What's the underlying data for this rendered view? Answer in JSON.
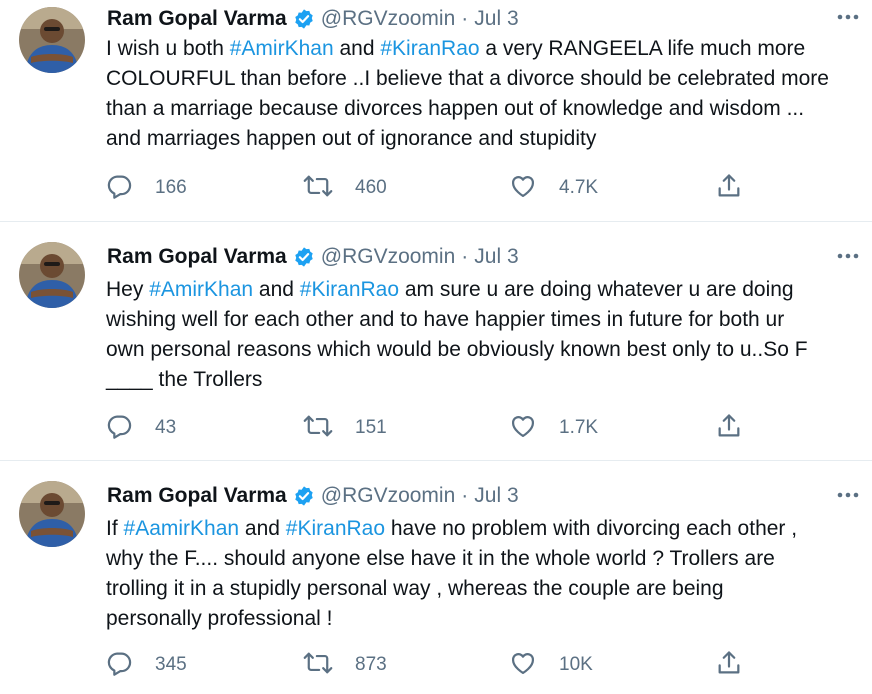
{
  "colors": {
    "hashtag": "#1b95e0",
    "verified": "#1da1f2",
    "muted": "#5b7083",
    "text": "#0f1419"
  },
  "tweets": [
    {
      "author": {
        "name": "Ram Gopal Varma",
        "handle": "@RGVzoomin",
        "separator": "·",
        "date": "Jul 3"
      },
      "lines": [
        [
          {
            "t": "I wish u both  "
          },
          {
            "t": "#AmirKhan",
            "h": true
          },
          {
            "t": " and "
          },
          {
            "t": "#KiranRao",
            "h": true
          },
          {
            "t": " a very RANGEELA life much more"
          }
        ],
        [
          {
            "t": "COLOURFUL than before ..I believe that a divorce should be celebrated more"
          }
        ],
        [
          {
            "t": "than a marriage because divorces happen out of knowledge and wisdom ..."
          }
        ],
        [
          {
            "t": "and marriages happen out of ignorance and stupidity"
          }
        ]
      ],
      "replies": "166",
      "retweets": "460",
      "likes": "4.7K"
    },
    {
      "author": {
        "name": "Ram Gopal Varma",
        "handle": "@RGVzoomin",
        "separator": "·",
        "date": "Jul 3"
      },
      "lines": [
        [
          {
            "t": "Hey "
          },
          {
            "t": "#AmirKhan",
            "h": true
          },
          {
            "t": " and "
          },
          {
            "t": "#KiranRao",
            "h": true
          },
          {
            "t": " am sure u are doing whatever u are doing"
          }
        ],
        [
          {
            "t": "wishing well for each other and to have happier times in future for both ur"
          }
        ],
        [
          {
            "t": "own personal reasons which would be obviously known best only to u..So F"
          }
        ],
        [
          {
            "t": "____ the Trollers"
          }
        ]
      ],
      "replies": "43",
      "retweets": "151",
      "likes": "1.7K"
    },
    {
      "author": {
        "name": "Ram Gopal Varma",
        "handle": "@RGVzoomin",
        "separator": "·",
        "date": "Jul 3"
      },
      "lines": [
        [
          {
            "t": "If  "
          },
          {
            "t": "#AamirKhan",
            "h": true
          },
          {
            "t": " and "
          },
          {
            "t": "#KiranRao",
            "h": true
          },
          {
            "t": " have no problem with divorcing each other ,"
          }
        ],
        [
          {
            "t": "why the F.... should anyone else have it in the whole world ? Trollers are"
          }
        ],
        [
          {
            "t": "trolling it in a stupidly personal way , whereas the couple are being"
          }
        ],
        [
          {
            "t": "personally professional !"
          }
        ]
      ],
      "replies": "345",
      "retweets": "873",
      "likes": "10K"
    }
  ],
  "icons": {
    "avatar": "profile-photo",
    "verified": "verified-badge-icon",
    "more": "more-horizontal-icon",
    "reply": "reply-icon",
    "retweet": "retweet-icon",
    "like": "heart-icon",
    "share": "share-icon"
  }
}
